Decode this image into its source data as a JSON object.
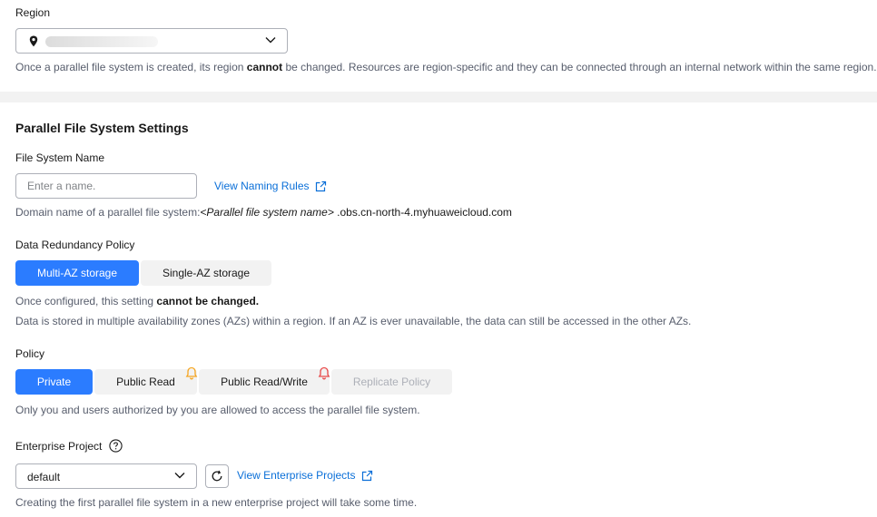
{
  "region": {
    "label": "Region",
    "hint_pre": "Once a parallel file system is created, its region ",
    "hint_bold": "cannot",
    "hint_post": " be changed. Resources are region-specific and they can be connected through an internal network within the same region."
  },
  "settings": {
    "title": "Parallel File System Settings"
  },
  "name": {
    "label": "File System Name",
    "placeholder": "Enter a name.",
    "naming_rules_link": "View Naming Rules",
    "domain_prefix": "Domain name of a parallel file system:",
    "domain_placeholder": "<Parallel file system name>",
    "domain_suffix": " .obs.cn-north-4.myhuaweicloud.com"
  },
  "redundancy": {
    "label": "Data Redundancy Policy",
    "options": [
      "Multi-AZ storage",
      "Single-AZ storage"
    ],
    "selected": "Multi-AZ storage",
    "hint1_pre": "Once configured, this setting ",
    "hint1_bold": "cannot be changed.",
    "hint2": "Data is stored in multiple availability zones (AZs) within a region. If an AZ is ever unavailable, the data can still be accessed in the other AZs."
  },
  "policy": {
    "label": "Policy",
    "options": [
      "Private",
      "Public Read",
      "Public Read/Write",
      "Replicate Policy"
    ],
    "selected": "Private",
    "hint": "Only you and users authorized by you are allowed to access the parallel file system.",
    "colors": {
      "warn": "#f5a623",
      "danger": "#e84a4a"
    }
  },
  "enterprise": {
    "label": "Enterprise Project",
    "value": "default",
    "view_link": "View Enterprise Projects",
    "hint": "Creating the first parallel file system in a new enterprise project will take some time."
  },
  "colors": {
    "accent": "#2b7cff",
    "link": "#0a6fd8",
    "hint_text": "#575d6c"
  }
}
